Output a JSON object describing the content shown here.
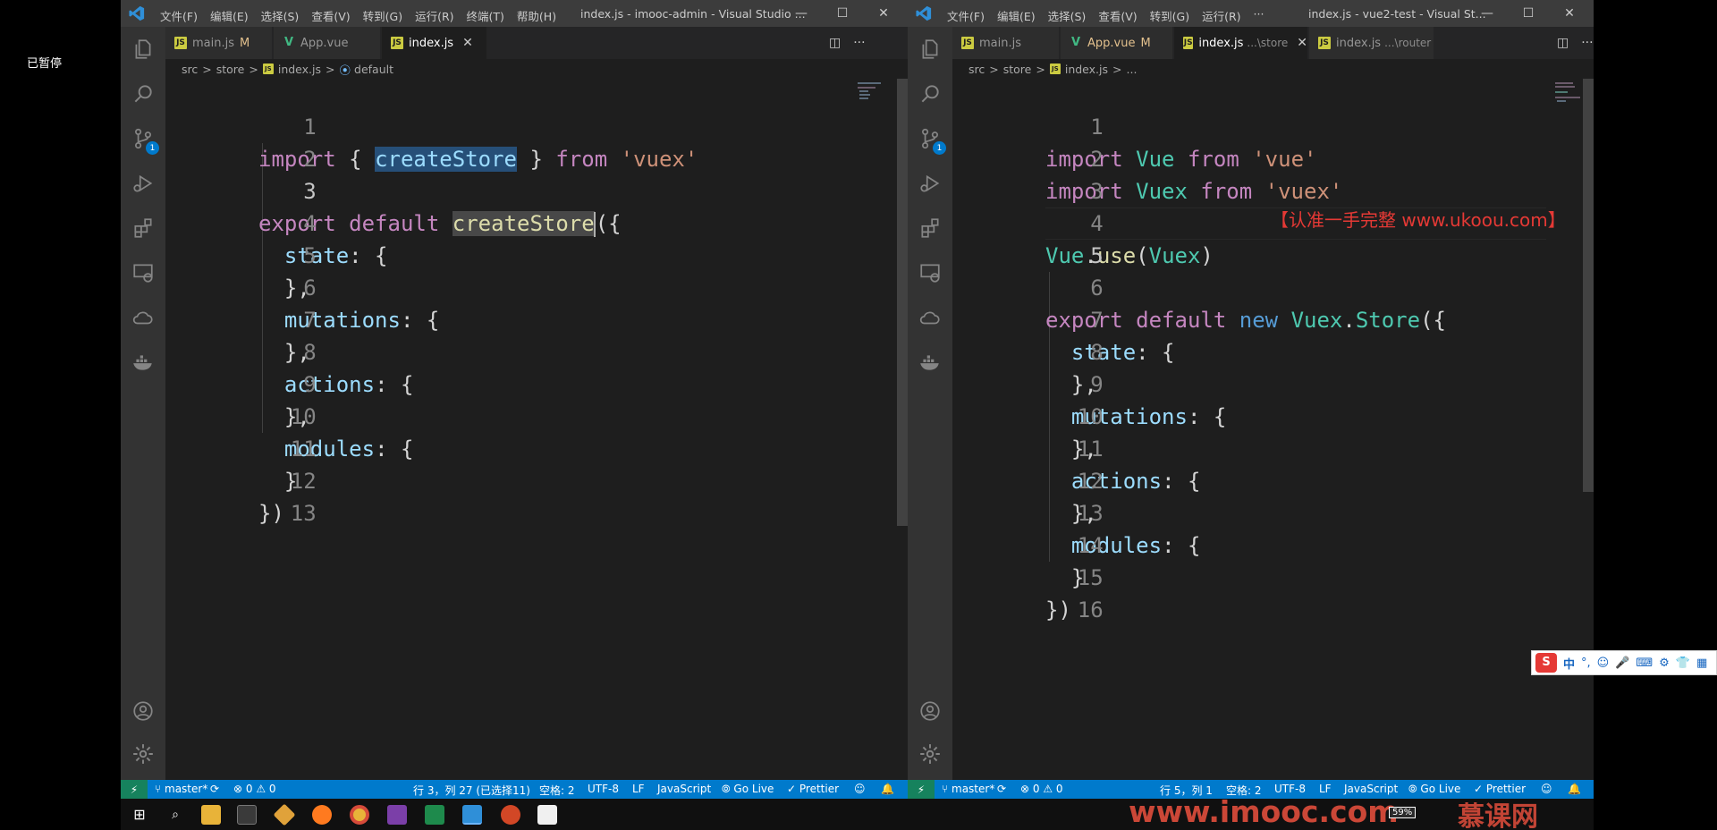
{
  "overlay": {
    "paused_label": "已暂停"
  },
  "left_window": {
    "title": "index.js - imooc-admin - Visual Studio ...",
    "menu": [
      "文件(F)",
      "编辑(E)",
      "选择(S)",
      "查看(V)",
      "转到(G)",
      "运行(R)",
      "终端(T)",
      "帮助(H)"
    ],
    "window_controls": {
      "minimize": "—",
      "maximize": "☐",
      "close": "✕"
    },
    "tabs": [
      {
        "label": "main.js",
        "badge": "M",
        "icon": "js"
      },
      {
        "label": "App.vue",
        "badge": "",
        "icon": "vue"
      },
      {
        "label": "index.js",
        "badge": "",
        "icon": "js",
        "close": "✕"
      }
    ],
    "breadcrumb": [
      "src",
      "store",
      "index.js",
      "default"
    ],
    "breadcrumb_sep": ">",
    "code_lines": [
      "import { createStore } from 'vuex'",
      "",
      "export default createStore({",
      "  state: {",
      "  },",
      "  mutations: {",
      "  },",
      "  actions: {",
      "  },",
      "  modules: {",
      "  }",
      "})",
      ""
    ],
    "line_numbers": [
      "1",
      "2",
      "3",
      "4",
      "5",
      "6",
      "7",
      "8",
      "9",
      "10",
      "11",
      "12",
      "13"
    ],
    "status": {
      "branch": "master*",
      "problems": "⊗ 0 ⚠ 0",
      "position": "行 3，列 27 (已选择11)",
      "spaces": "空格: 2",
      "encoding": "UTF-8",
      "eol": "LF",
      "language": "JavaScript",
      "golive": "Go Live",
      "prettier": "Prettier"
    }
  },
  "right_window": {
    "title": "index.js - vue2-test - Visual St...",
    "menu": [
      "文件(F)",
      "编辑(E)",
      "选择(S)",
      "查看(V)",
      "转到(G)",
      "运行(R)",
      "···"
    ],
    "window_controls": {
      "minimize": "—",
      "maximize": "☐",
      "close": "✕"
    },
    "tabs": [
      {
        "label": "main.js",
        "badge": "",
        "icon": "js"
      },
      {
        "label": "App.vue",
        "badge": "M",
        "icon": "vue"
      },
      {
        "label": "index.js",
        "suffix": "...\\store",
        "icon": "js",
        "close": "✕"
      },
      {
        "label": "index.js",
        "suffix": "...\\router",
        "icon": "js"
      }
    ],
    "breadcrumb": [
      "src",
      "store",
      "index.js",
      "..."
    ],
    "breadcrumb_sep": ">",
    "watermark": "【认准一手完整 www.ukoou.com】",
    "code_lines": [
      "import Vue from 'vue'",
      "import Vuex from 'vuex'",
      "",
      "Vue.use(Vuex)",
      "",
      "export default new Vuex.Store({",
      "  state: {",
      "  },",
      "  mutations: {",
      "  },",
      "  actions: {",
      "  },",
      "  modules: {",
      "  }",
      "})",
      ""
    ],
    "line_numbers": [
      "1",
      "2",
      "3",
      "4",
      "5",
      "6",
      "7",
      "8",
      "9",
      "10",
      "11",
      "12",
      "13",
      "14",
      "15",
      "16"
    ],
    "status": {
      "branch": "master*",
      "problems": "⊗ 0 ⚠ 0",
      "position": "行 5，列 1",
      "spaces": "空格: 2",
      "encoding": "UTF-8",
      "eol": "LF",
      "language": "JavaScript",
      "golive": "Go Live",
      "prettier": "Prettier"
    }
  },
  "taskbar": {
    "watermark": "www.imooc.com",
    "brand": "慕课网",
    "battery": "59%"
  },
  "ime": {
    "logo": "S",
    "mode": "中",
    "punct": "°,",
    "icons": [
      "☺",
      "🎤",
      "⌨",
      "⚙",
      "👕",
      "▦"
    ]
  },
  "colors": {
    "status_bar": "#007acc",
    "activity_bar": "#333333",
    "editor_bg": "#1e1e1e",
    "title_bar": "#3c3c3c"
  }
}
